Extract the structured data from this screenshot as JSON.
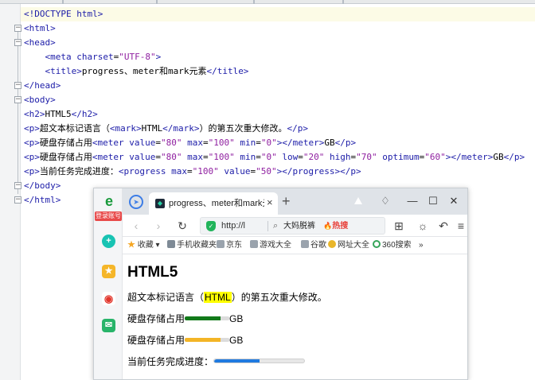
{
  "editor": {
    "lines": [
      [
        [
          "t",
          "<!DOCTYPE "
        ],
        [
          "a",
          "html"
        ],
        [
          "t",
          ">"
        ]
      ],
      [
        [
          "t",
          "<html>"
        ]
      ],
      [
        [
          "t",
          "<head>"
        ]
      ],
      [
        [
          "x",
          "    "
        ],
        [
          "t",
          "<meta "
        ],
        [
          "a",
          "charset"
        ],
        [
          "x",
          "="
        ],
        [
          "v",
          "\"UTF-8\""
        ],
        [
          "t",
          ">"
        ]
      ],
      [
        [
          "x",
          "    "
        ],
        [
          "t",
          "<title>"
        ],
        [
          "x",
          "progress、meter和mark元素"
        ],
        [
          "t",
          "</title>"
        ]
      ],
      [
        [
          "t",
          "</head>"
        ]
      ],
      [
        [
          "t",
          "<body>"
        ]
      ],
      [
        [
          "t",
          "<h2>"
        ],
        [
          "x",
          "HTML5"
        ],
        [
          "t",
          "</h2>"
        ]
      ],
      [
        [
          "t",
          "<p>"
        ],
        [
          "x",
          "超文本标记语言（"
        ],
        [
          "t",
          "<mark>"
        ],
        [
          "x",
          "HTML"
        ],
        [
          "t",
          "</mark>"
        ],
        [
          "x",
          "）的第五次重大修改。"
        ],
        [
          "t",
          "</p>"
        ]
      ],
      [
        [
          "t",
          "<p>"
        ],
        [
          "x",
          "硬盘存储占用"
        ],
        [
          "t",
          "<meter "
        ],
        [
          "a",
          "value"
        ],
        [
          "x",
          "="
        ],
        [
          "v",
          "\"80\" "
        ],
        [
          "a",
          "max"
        ],
        [
          "x",
          "="
        ],
        [
          "v",
          "\"100\" "
        ],
        [
          "a",
          "min"
        ],
        [
          "x",
          "="
        ],
        [
          "v",
          "\"0\""
        ],
        [
          "t",
          "></meter>"
        ],
        [
          "x",
          "GB"
        ],
        [
          "t",
          "</p>"
        ]
      ],
      [
        [
          "t",
          "<p>"
        ],
        [
          "x",
          "硬盘存储占用"
        ],
        [
          "t",
          "<meter "
        ],
        [
          "a",
          "value"
        ],
        [
          "x",
          "="
        ],
        [
          "v",
          "\"80\" "
        ],
        [
          "a",
          "max"
        ],
        [
          "x",
          "="
        ],
        [
          "v",
          "\"100\" "
        ],
        [
          "a",
          "min"
        ],
        [
          "x",
          "="
        ],
        [
          "v",
          "\"0\" "
        ],
        [
          "a",
          "low"
        ],
        [
          "x",
          "="
        ],
        [
          "v",
          "\"20\" "
        ],
        [
          "a",
          "high"
        ],
        [
          "x",
          "="
        ],
        [
          "v",
          "\"70\" "
        ],
        [
          "a",
          "optimum"
        ],
        [
          "x",
          "="
        ],
        [
          "v",
          "\"60\""
        ],
        [
          "t",
          "></meter>"
        ],
        [
          "x",
          "GB"
        ],
        [
          "t",
          "</p>"
        ]
      ],
      [
        [
          "t",
          "<p>"
        ],
        [
          "x",
          "当前任务完成进度："
        ],
        [
          "t",
          "<progress "
        ],
        [
          "a",
          "max"
        ],
        [
          "x",
          "="
        ],
        [
          "v",
          "\"100\" "
        ],
        [
          "a",
          "value"
        ],
        [
          "x",
          "="
        ],
        [
          "v",
          "\"50\""
        ],
        [
          "t",
          "></progress>"
        ],
        [
          "t",
          "</p>"
        ]
      ],
      [
        [
          "t",
          "</body>"
        ]
      ],
      [
        [
          "t",
          "</html>"
        ]
      ]
    ]
  },
  "browser": {
    "sidebar": {
      "login_label": "登录账号"
    },
    "tab_title": "progress、meter和mark元素",
    "url_text": "http://l",
    "search_value": "大妈脱裤",
    "hot_label": "热搜",
    "bookmarks": [
      "收藏",
      "手机收藏夹",
      "京东",
      "游戏大全",
      "谷歌",
      "网址大全",
      "360搜索",
      "»"
    ],
    "page": {
      "heading": "HTML5",
      "p1_before": "超文本标记语言（",
      "p1_mark": "HTML",
      "p1_after": "）的第五次重大修改。",
      "meter1_prefix": "硬盘存储占用",
      "meter1_suffix": "GB",
      "meter1_value": 80,
      "meter1_color": "#127a1a",
      "meter2_prefix": "硬盘存储占用",
      "meter2_suffix": "GB",
      "meter2_value": 80,
      "meter2_color": "#f3b526",
      "progress_prefix": "当前任务完成进度：",
      "progress_value": 50
    }
  }
}
